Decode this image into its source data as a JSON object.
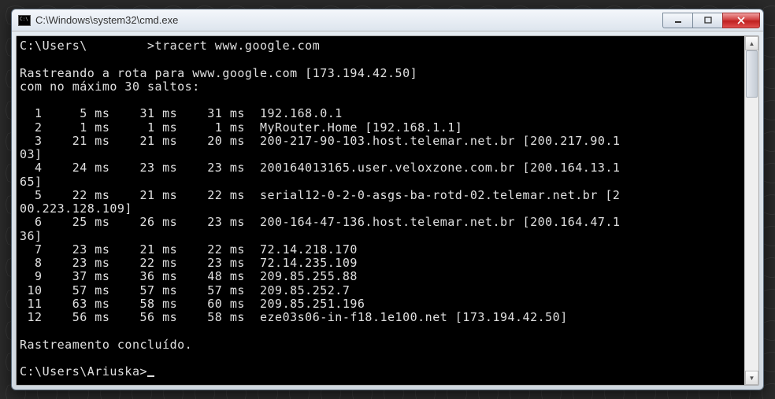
{
  "window": {
    "title": "C:\\Windows\\system32\\cmd.exe"
  },
  "prompt1": {
    "path": "C:\\Users\\",
    "user_redacted": "        ",
    "command": ">tracert www.google.com"
  },
  "trace_header": {
    "line1": "Rastreando a rota para www.google.com [173.194.42.50]",
    "line2": "com no máximo 30 saltos:"
  },
  "hops": [
    {
      "n": "  1",
      "t1": "    5 ms",
      "t2": "   31 ms",
      "t3": "   31 ms",
      "host": "192.168.0.1"
    },
    {
      "n": "  2",
      "t1": "    1 ms",
      "t2": "    1 ms",
      "t3": "    1 ms",
      "host": "MyRouter.Home [192.168.1.1]"
    },
    {
      "n": "  3",
      "t1": "   21 ms",
      "t2": "   21 ms",
      "t3": "   20 ms",
      "host": "200-217-90-103.host.telemar.net.br [200.217.90.1",
      "wrap": "03]"
    },
    {
      "n": "  4",
      "t1": "   24 ms",
      "t2": "   23 ms",
      "t3": "   23 ms",
      "host": "200164013165.user.veloxzone.com.br [200.164.13.1",
      "wrap": "65]"
    },
    {
      "n": "  5",
      "t1": "   22 ms",
      "t2": "   21 ms",
      "t3": "   22 ms",
      "host": "serial12-0-2-0-asgs-ba-rotd-02.telemar.net.br [2",
      "wrap": "00.223.128.109]"
    },
    {
      "n": "  6",
      "t1": "   25 ms",
      "t2": "   26 ms",
      "t3": "   23 ms",
      "host": "200-164-47-136.host.telemar.net.br [200.164.47.1",
      "wrap": "36]"
    },
    {
      "n": "  7",
      "t1": "   23 ms",
      "t2": "   21 ms",
      "t3": "   22 ms",
      "host": "72.14.218.170"
    },
    {
      "n": "  8",
      "t1": "   23 ms",
      "t2": "   22 ms",
      "t3": "   23 ms",
      "host": "72.14.235.109"
    },
    {
      "n": "  9",
      "t1": "   37 ms",
      "t2": "   36 ms",
      "t3": "   48 ms",
      "host": "209.85.255.88"
    },
    {
      "n": " 10",
      "t1": "   57 ms",
      "t2": "   57 ms",
      "t3": "   57 ms",
      "host": "209.85.252.7"
    },
    {
      "n": " 11",
      "t1": "   63 ms",
      "t2": "   58 ms",
      "t3": "   60 ms",
      "host": "209.85.251.196"
    },
    {
      "n": " 12",
      "t1": "   56 ms",
      "t2": "   56 ms",
      "t3": "   58 ms",
      "host": "eze03s06-in-f18.1e100.net [173.194.42.50]"
    }
  ],
  "trace_footer": "Rastreamento concluído.",
  "prompt2": "C:\\Users\\Ariuska>"
}
